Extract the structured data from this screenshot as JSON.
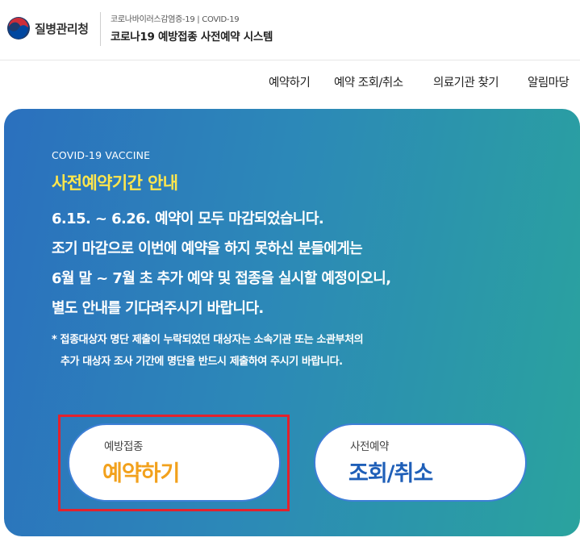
{
  "header": {
    "agency_name": "질병관리청",
    "system_subtitle": "코로나바이러스감염증-19 | COVID-19",
    "system_title": "코로나19 예방접종 사전예약 시스템",
    "logo_icon": "taegeuk-logo-icon",
    "logo_colors": {
      "red": "#cd2e3a",
      "blue": "#0047a0",
      "dark": "#1d3b6d"
    }
  },
  "nav": {
    "items": [
      {
        "label": "예약하기"
      },
      {
        "label": "예약 조회/취소"
      },
      {
        "label": "의료기관 찾기"
      },
      {
        "label": "알림마당"
      }
    ]
  },
  "banner": {
    "kicker": "COVID-19 VACCINE",
    "title": "사전예약기간 안내",
    "lines": [
      "6.15. ~ 6.26. 예약이 모두 마감되었습니다.",
      "조기 마감으로 이번에 예약을 하지 못하신 분들에게는",
      "6월 말 ~ 7월 초 추가 예약 및 접종을 실시할 예정이오니,",
      "별도 안내를 기다려주시기 바랍니다."
    ],
    "notes": [
      "* 접종대상자 명단 제출이 누락되었던 대상자는 소속기관 또는 소관부처의",
      "추가 대상자 조사 기간에 명단을 반드시 제출하여 주시기 바랍니다."
    ],
    "buttons": {
      "reserve": {
        "sub": "예방접종",
        "main": "예약하기"
      },
      "lookup": {
        "sub": "사전예약",
        "main": "조회/취소"
      }
    },
    "colors": {
      "title_yellow": "#ffe64d",
      "reserve_orange": "#f2a11c",
      "lookup_blue": "#1f5fb8",
      "highlight_red": "#e3222d"
    }
  }
}
